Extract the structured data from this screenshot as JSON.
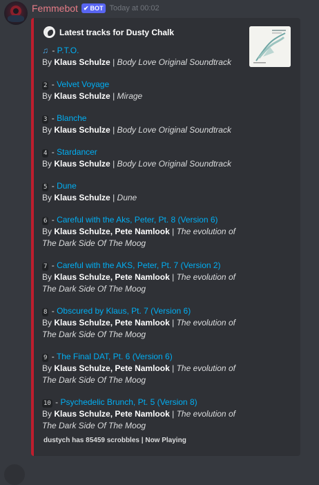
{
  "message": {
    "username": "Femmebot",
    "bot_tag": "BOT",
    "timestamp": "Today at 00:02"
  },
  "embed": {
    "author": "Latest tracks for Dusty Chalk",
    "accent_color": "#be1e2d",
    "thumbnail": "album-art",
    "tracks": [
      {
        "num": "",
        "icon": "music-note-icon",
        "title": "P.T.O.",
        "by_label": "By",
        "artist": "Klaus Schulze",
        "sep": "|",
        "album": "Body Love Original Soundtrack"
      },
      {
        "num": "2",
        "title": "Velvet Voyage",
        "by_label": "By",
        "artist": "Klaus Schulze",
        "sep": "|",
        "album": "Mirage"
      },
      {
        "num": "3",
        "title": "Blanche",
        "by_label": "By",
        "artist": "Klaus Schulze",
        "sep": "|",
        "album": "Body Love Original Soundtrack"
      },
      {
        "num": "4",
        "title": "Stardancer",
        "by_label": "By",
        "artist": "Klaus Schulze",
        "sep": "|",
        "album": "Body Love Original Soundtrack"
      },
      {
        "num": "5",
        "title": "Dune",
        "by_label": "By",
        "artist": "Klaus Schulze",
        "sep": "|",
        "album": "Dune"
      },
      {
        "num": "6",
        "title": "Careful with the Aks, Peter, Pt. 8 (Version 6)",
        "by_label": "By",
        "artist": "Klaus Schulze, Pete Namlook",
        "sep": "|",
        "album": "The evolution of The Dark Side Of The Moog"
      },
      {
        "num": "7",
        "title": "Careful with the AKS, Peter, Pt. 7 (Version 2)",
        "by_label": "By",
        "artist": "Klaus Schulze, Pete Namlook",
        "sep": "|",
        "album": "The evolution of The Dark Side Of The Moog"
      },
      {
        "num": "8",
        "title": "Obscured by Klaus, Pt. 7 (Version 6)",
        "by_label": "By",
        "artist": "Klaus Schulze, Pete Namlook",
        "sep": "|",
        "album": "The evolution of The Dark Side Of The Moog"
      },
      {
        "num": "9",
        "title": "The Final DAT, Pt. 6 (Version 6)",
        "by_label": "By",
        "artist": "Klaus Schulze, Pete Namlook",
        "sep": "|",
        "album": "The evolution of The Dark Side Of The Moog"
      },
      {
        "num": "10",
        "title": "Psychedelic Brunch, Pt. 5 (Version 8)",
        "by_label": "By",
        "artist": "Klaus Schulze, Pete Namlook",
        "sep": "|",
        "album": "The evolution of The Dark Side Of The Moog"
      }
    ],
    "footer": {
      "scrobbles": "dustych has 85459 scrobbles",
      "sep": "|",
      "status": "Now Playing"
    }
  }
}
